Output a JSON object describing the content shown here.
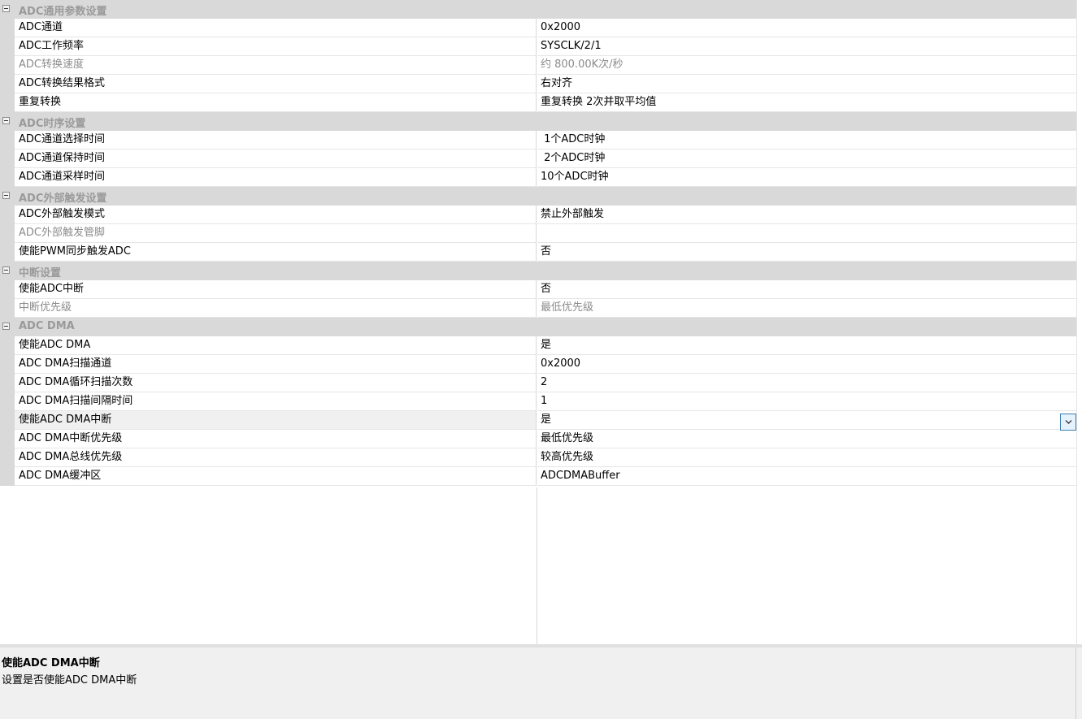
{
  "property_grid": {
    "categories": [
      {
        "label": "ADC通用参数设置",
        "properties": [
          {
            "name": "ADC通道",
            "value": "0x2000",
            "readonly": false
          },
          {
            "name": "ADC工作频率",
            "value": "SYSCLK/2/1",
            "readonly": false
          },
          {
            "name": "ADC转换速度",
            "value": "约 800.00K次/秒",
            "readonly": true
          },
          {
            "name": "ADC转换结果格式",
            "value": "右对齐",
            "readonly": false
          },
          {
            "name": "重复转换",
            "value": "重复转换 2次并取平均值",
            "readonly": false
          }
        ]
      },
      {
        "label": "ADC时序设置",
        "properties": [
          {
            "name": "ADC通道选择时间",
            "value": " 1个ADC时钟",
            "readonly": false
          },
          {
            "name": "ADC通道保持时间",
            "value": " 2个ADC时钟",
            "readonly": false
          },
          {
            "name": "ADC通道采样时间",
            "value": "10个ADC时钟",
            "readonly": false
          }
        ]
      },
      {
        "label": "ADC外部触发设置",
        "properties": [
          {
            "name": "ADC外部触发模式",
            "value": "禁止外部触发",
            "readonly": false
          },
          {
            "name": "ADC外部触发管脚",
            "value": "",
            "readonly": true
          },
          {
            "name": "使能PWM同步触发ADC",
            "value": "否",
            "readonly": false
          }
        ]
      },
      {
        "label": "中断设置",
        "properties": [
          {
            "name": "使能ADC中断",
            "value": "否",
            "readonly": false
          },
          {
            "name": "中断优先级",
            "value": "最低优先级",
            "readonly": true
          }
        ]
      },
      {
        "label": "ADC DMA",
        "properties": [
          {
            "name": "使能ADC DMA",
            "value": "是",
            "readonly": false
          },
          {
            "name": "ADC DMA扫描通道",
            "value": "0x2000",
            "readonly": false
          },
          {
            "name": "ADC DMA循环扫描次数",
            "value": "2",
            "readonly": false
          },
          {
            "name": "ADC DMA扫描间隔时间",
            "value": "1",
            "readonly": false
          },
          {
            "name": "使能ADC DMA中断",
            "value": "是",
            "readonly": false,
            "selected": true
          },
          {
            "name": "ADC DMA中断优先级",
            "value": "最低优先级",
            "readonly": false
          },
          {
            "name": "ADC DMA总线优先级",
            "value": "较高优先级",
            "readonly": false
          },
          {
            "name": "ADC DMA缓冲区",
            "value": "ADCDMABuffer",
            "readonly": false
          }
        ]
      }
    ]
  },
  "description": {
    "title": "使能ADC DMA中断",
    "text": "设置是否使能ADC DMA中断"
  },
  "icons": {
    "collapse": "collapse-minus-icon",
    "dropdown": "chevron-down-icon"
  },
  "colors": {
    "category_bg": "#d9d9d9",
    "readonly_text": "#8c8c8c",
    "dropdown_border": "#3c7fb1"
  }
}
